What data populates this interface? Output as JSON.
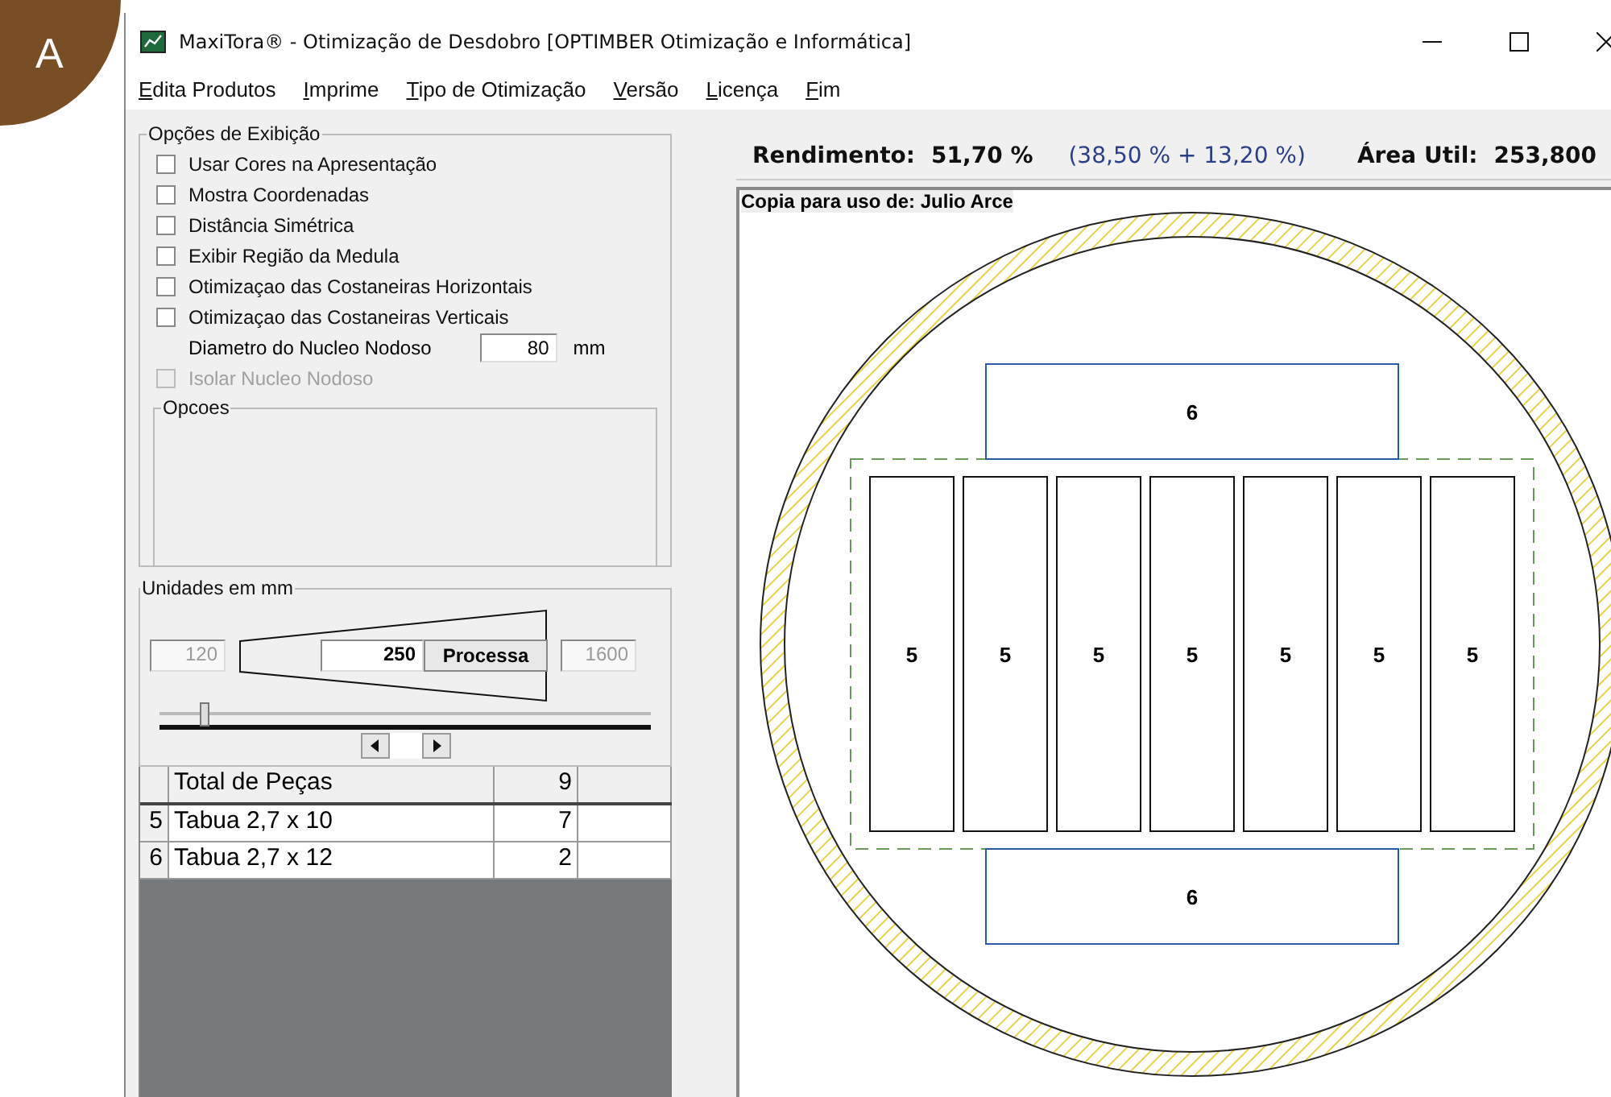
{
  "figure_label": "A",
  "window": {
    "title": "MaxiTora® - Otimização de Desdobro   [OPTIMBER Otimização e Informática]"
  },
  "menu": [
    {
      "label": "Edita Produtos"
    },
    {
      "label": "Imprime"
    },
    {
      "label": "Tipo de Otimização"
    },
    {
      "label": "Versão"
    },
    {
      "label": "Licença"
    },
    {
      "label": "Fim"
    }
  ],
  "display_options": {
    "title": "Opções de Exibição",
    "checkboxes": [
      {
        "label": "Usar Cores na Apresentação",
        "checked": false,
        "disabled": false
      },
      {
        "label": "Mostra Coordenadas",
        "checked": false,
        "disabled": false
      },
      {
        "label": "Distância Simétrica",
        "checked": false,
        "disabled": false
      },
      {
        "label": "Exibir Região da Medula",
        "checked": false,
        "disabled": false
      },
      {
        "label": "Otimizaçao das Costaneiras Horizontais",
        "checked": false,
        "disabled": false
      },
      {
        "label": "Otimizaçao das Costaneiras Verticais",
        "checked": false,
        "disabled": false
      }
    ],
    "diameter": {
      "label": "Diametro do Nucleo Nodoso",
      "value": "80",
      "unit": "mm"
    },
    "isolate": {
      "label": "Isolar Nucleo Nodoso",
      "checked": false,
      "disabled": true
    },
    "options_group": {
      "title": "Opcoes"
    }
  },
  "units": {
    "title": "Unidades em mm",
    "min": "120",
    "value": "250",
    "max": "1600",
    "button": "Processa",
    "level": 0.09
  },
  "grid": {
    "total": {
      "label": "Total de Peças",
      "count": "9"
    },
    "rows": [
      {
        "index": "5",
        "name": "Tabua 2,7 x 10",
        "count": "7"
      },
      {
        "index": "6",
        "name": "Tabua 2,7 x 12",
        "count": "2"
      }
    ]
  },
  "results": {
    "yield_label": "Rendimento:",
    "yield_value": "51,70 %",
    "breakdown": "(38,50 % + 13,20 %)",
    "area_label": "Área Util:",
    "area_value": "253,800"
  },
  "canvas": {
    "copy_note": "Copia para uso de: Julio Arce",
    "top_boards": [
      {
        "label": "6"
      }
    ],
    "middle_boards": [
      {
        "label": "5"
      },
      {
        "label": "5"
      },
      {
        "label": "5"
      },
      {
        "label": "5"
      },
      {
        "label": "5"
      },
      {
        "label": "5"
      },
      {
        "label": "5"
      }
    ],
    "bottom_boards": [
      {
        "label": "6"
      }
    ]
  }
}
